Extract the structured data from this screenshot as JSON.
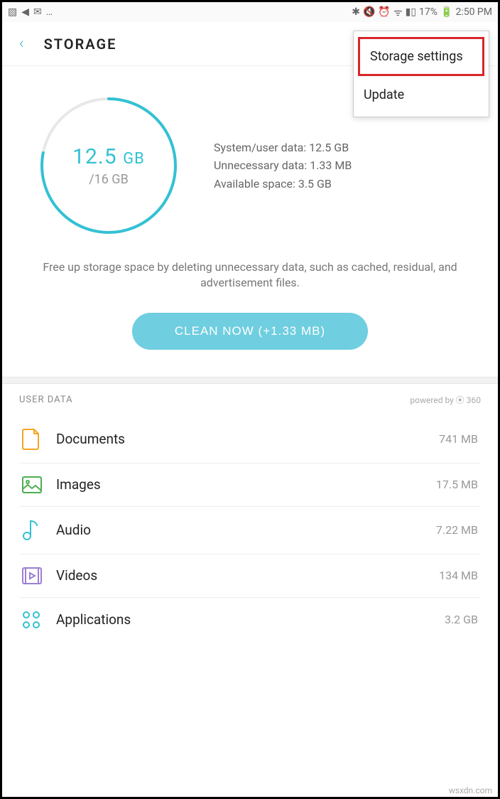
{
  "status": {
    "battery_pct": "17%",
    "time": "2:50 PM"
  },
  "header": {
    "title": "STORAGE"
  },
  "popup": {
    "storage_settings": "Storage settings",
    "update": "Update"
  },
  "ring": {
    "used_val": "12.5",
    "used_unit": "GB",
    "total": "/16 GB",
    "percent": 78
  },
  "details": {
    "l1": "System/user data: 12.5 GB",
    "l2": "Unnecessary data: 1.33 MB",
    "l3": "Available space: 3.5 GB"
  },
  "description": "Free up storage space by deleting unnecessary data, such as cached, residual, and advertisement files.",
  "clean_label": "CLEAN NOW (+1.33 MB)",
  "section": {
    "title": "USER DATA",
    "powered_by": "powered by ⦿ 360"
  },
  "rows": {
    "documents": {
      "label": "Documents",
      "size": "741 MB"
    },
    "images": {
      "label": "Images",
      "size": "17.5 MB"
    },
    "audio": {
      "label": "Audio",
      "size": "7.22 MB"
    },
    "videos": {
      "label": "Videos",
      "size": "134 MB"
    },
    "applications": {
      "label": "Applications",
      "size": "3.2 GB"
    }
  },
  "watermark": "wsxdn.com"
}
